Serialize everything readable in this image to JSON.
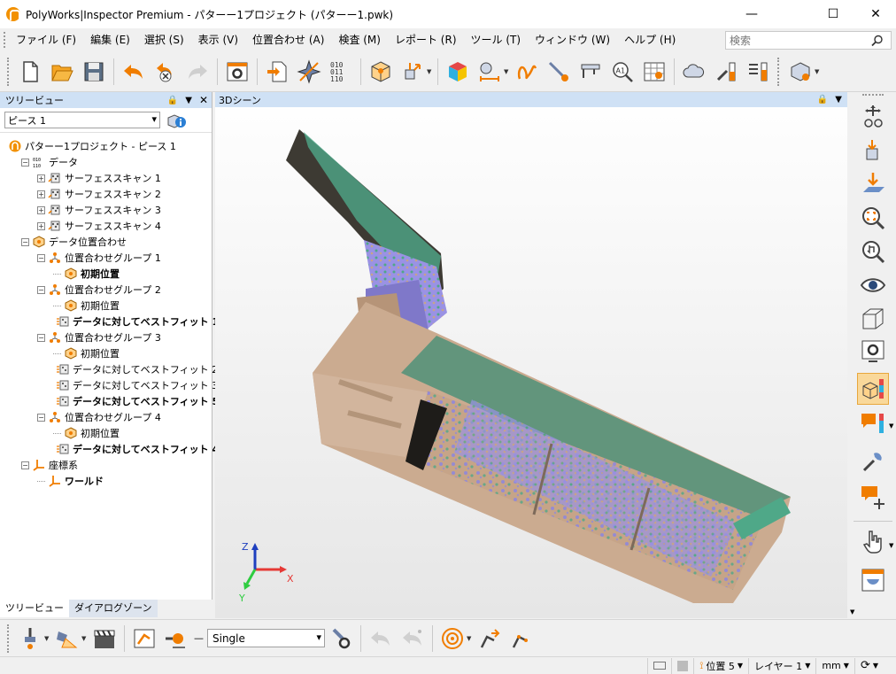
{
  "window": {
    "title": "PolyWorks|Inspector Premium - パターー1プロジェクト (パターー1.pwk)"
  },
  "menu": [
    {
      "label": "ファイル (F)",
      "x": 8
    },
    {
      "label": "編集 (E)"
    },
    {
      "label": "選択 (S)"
    },
    {
      "label": "表示 (V)"
    },
    {
      "label": "位置合わせ (A)"
    },
    {
      "label": "検査 (M)"
    },
    {
      "label": "レポート (R)"
    },
    {
      "label": "ツール (T)"
    },
    {
      "label": "ウィンドウ (W)"
    },
    {
      "label": "ヘルプ (H)"
    }
  ],
  "search": {
    "placeholder": "検索"
  },
  "tree_panel": {
    "title": "ツリービュー",
    "piece": "ピース 1",
    "tabs": [
      "ツリービュー",
      "ダイアログゾーン"
    ]
  },
  "tree": [
    {
      "level": 0,
      "label": "パターー1プロジェクト - ピース 1",
      "icon": "project-icon",
      "bold": false,
      "exp": ""
    },
    {
      "level": 1,
      "label": "データ",
      "icon": "data-icon",
      "bold": false,
      "exp": "-"
    },
    {
      "level": 2,
      "label": "サーフェススキャン 1",
      "icon": "scan-icon",
      "bold": false,
      "exp": "+"
    },
    {
      "level": 2,
      "label": "サーフェススキャン 2",
      "icon": "scan-icon",
      "bold": false,
      "exp": "+"
    },
    {
      "level": 2,
      "label": "サーフェススキャン 3",
      "icon": "scan-icon",
      "bold": false,
      "exp": "+"
    },
    {
      "level": 2,
      "label": "サーフェススキャン 4",
      "icon": "scan-icon",
      "bold": false,
      "exp": "+"
    },
    {
      "level": 1,
      "label": "データ位置合わせ",
      "icon": "alignment-icon",
      "bold": false,
      "exp": "-"
    },
    {
      "level": 2,
      "label": "位置合わせグループ 1",
      "icon": "group-icon",
      "bold": false,
      "exp": "-"
    },
    {
      "level": 3,
      "label": "初期位置",
      "icon": "initial-position-icon",
      "bold": true,
      "exp": ""
    },
    {
      "level": 2,
      "label": "位置合わせグループ 2",
      "icon": "group-icon",
      "bold": false,
      "exp": "-"
    },
    {
      "level": 3,
      "label": "初期位置",
      "icon": "initial-position-icon",
      "bold": false,
      "exp": ""
    },
    {
      "level": 3,
      "label": "データに対してベストフィット 1",
      "icon": "best-fit-icon",
      "bold": true,
      "exp": ""
    },
    {
      "level": 2,
      "label": "位置合わせグループ 3",
      "icon": "group-icon",
      "bold": false,
      "exp": "-"
    },
    {
      "level": 3,
      "label": "初期位置",
      "icon": "initial-position-icon",
      "bold": false,
      "exp": ""
    },
    {
      "level": 3,
      "label": "データに対してベストフィット 2",
      "icon": "best-fit-icon",
      "bold": false,
      "exp": ""
    },
    {
      "level": 3,
      "label": "データに対してベストフィット 3",
      "icon": "best-fit-icon",
      "bold": false,
      "exp": ""
    },
    {
      "level": 3,
      "label": "データに対してベストフィット 5",
      "icon": "best-fit-icon",
      "bold": true,
      "exp": ""
    },
    {
      "level": 2,
      "label": "位置合わせグループ 4",
      "icon": "group-icon",
      "bold": false,
      "exp": "-"
    },
    {
      "level": 3,
      "label": "初期位置",
      "icon": "initial-position-icon",
      "bold": false,
      "exp": ""
    },
    {
      "level": 3,
      "label": "データに対してベストフィット 4",
      "icon": "best-fit-icon",
      "bold": true,
      "exp": ""
    },
    {
      "level": 1,
      "label": "座標系",
      "icon": "coordinate-system-icon",
      "bold": false,
      "exp": "-"
    },
    {
      "level": 2,
      "label": "ワールド",
      "icon": "world-axes-icon",
      "bold": true,
      "exp": ""
    }
  ],
  "scene": {
    "title": "3Dシーン",
    "axes": {
      "x": "X",
      "y": "Y",
      "z": "Z"
    }
  },
  "bottom_bar": {
    "mode": "Single"
  },
  "status_bar": {
    "position": "位置 5",
    "layer": "レイヤー 1",
    "unit": "mm"
  },
  "colors": {
    "accent": "#f07d00",
    "header": "#cfe1f5",
    "scan_tan": "#c9a68a",
    "scan_green": "#4fa888",
    "scan_purple": "#8c86e0"
  }
}
